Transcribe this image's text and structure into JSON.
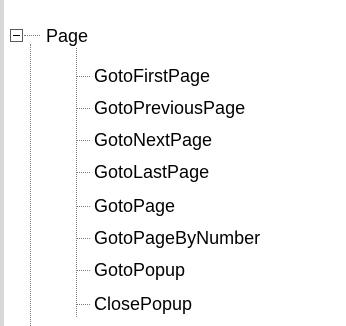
{
  "tree": {
    "root": {
      "label": "Page",
      "expander_state": "expanded",
      "expander_icon": "minus-box-icon"
    },
    "children": [
      {
        "label": "GotoFirstPage"
      },
      {
        "label": "GotoPreviousPage"
      },
      {
        "label": "GotoNextPage"
      },
      {
        "label": "GotoLastPage"
      },
      {
        "label": "GotoPage"
      },
      {
        "label": "GotoPageByNumber"
      },
      {
        "label": "GotoPopup"
      },
      {
        "label": "ClosePopup"
      }
    ]
  },
  "colors": {
    "background": "#ffffff",
    "text": "#000000",
    "connector": "#7a7a7a",
    "expander_border": "#5a5a5a",
    "left_edge": "#d8d8d8"
  }
}
